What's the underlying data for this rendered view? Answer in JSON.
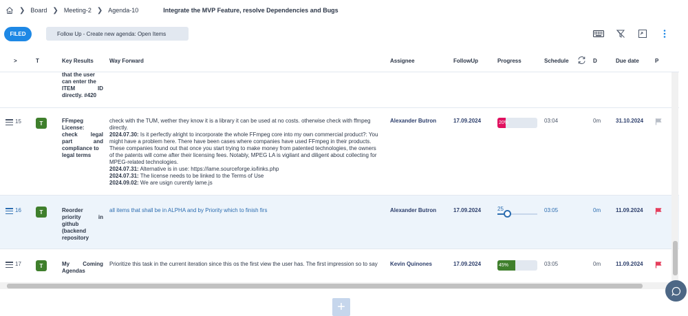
{
  "breadcrumb": {
    "items": [
      "Board",
      "Meeting-2",
      "Agenda-10"
    ],
    "title": "Integrate the MVP Feature, resolve Dependencies and Bugs"
  },
  "toolbar": {
    "filed_label": "FILED",
    "agenda_label": "Follow Up - Create new agenda: Open Items",
    "icons": [
      "keyboard-icon",
      "filter-off-icon",
      "fullscreen-icon",
      "more-vertical-icon"
    ]
  },
  "table": {
    "headers": {
      "expand": ">",
      "type": "T",
      "key_results": "Key Results",
      "way_forward": "Way Forward",
      "assignee": "Assignee",
      "followup": "FollowUp",
      "progress": "Progress",
      "schedule": "Schedule",
      "d": "D",
      "due_date": "Due date",
      "p": "P"
    },
    "partial_row": {
      "key_results_lines": [
        "that the user",
        "can enter the",
        "ITEM ID",
        "directly. #420"
      ]
    },
    "rows": [
      {
        "num": "15",
        "type": "T",
        "key_results_lines": [
          "FFmpeg",
          "License:",
          "check legal",
          "part and",
          "compliance to",
          "legal terms"
        ],
        "way_forward": {
          "intro": "check with the TUM, wether they know it is a library it can be used at no costs. otherwise check with ffmpeg directly.",
          "entries": [
            {
              "date": "2024.07.30:",
              "text": " Is it perfectly alright to incorporate the whole FFmpeg core into my own commercial product?: You might have a problem here. There have been cases where companies have used FFmpeg in their products. These companies found out that once you start trying to make money from patented technologies, the owners of the patents will come after their licensing fees. Notably, MPEG LA is vigilant and diligent about collecting for MPEG-related technologies."
            },
            {
              "date": "2024.07.31:",
              "text": "  Alternative is in use: https://lame.sourceforge.io/links.php"
            },
            {
              "date": "2024.07.31:",
              "text": "  The license needs to be linked to the Terms of Use"
            },
            {
              "date": "2024.09.02:",
              "text": "  We are usign curently lame.js"
            }
          ]
        },
        "assignee": "Alexander Butron",
        "followup": "17.09.2024",
        "progress": {
          "value": 20,
          "label": "20%",
          "color": "#e0115f"
        },
        "schedule": "03:04",
        "d": "0m",
        "due_date": "31.10.2024",
        "priority_color": "#b8bec7"
      },
      {
        "num": "16",
        "type": "T",
        "key_results_lines": [
          "Reorder",
          "priority in",
          "github",
          "(backend",
          "repository"
        ],
        "way_forward": "all items that shall be in ALPHA and by Priority which to finish firs",
        "assignee": "Alexander Butron",
        "followup": "17.09.2024",
        "progress": {
          "value": 25,
          "label": "25"
        },
        "schedule": "03:05",
        "d": "0m",
        "due_date": "11.09.2024",
        "priority_color": "#e53e5c"
      },
      {
        "num": "17",
        "type": "T",
        "key_results_lines": [
          "My Coming",
          "Agendas"
        ],
        "way_forward": "Prioritize this task in the current iteration since this os the first view the user has. The first impression so to say",
        "assignee": "Kevin Quinones",
        "followup": "17.09.2024",
        "progress": {
          "value": 45,
          "label": "45%",
          "color": "#3f7f2c"
        },
        "schedule": "03:05",
        "d": "0m",
        "due_date": "11.09.2024",
        "priority_color": "#e53e5c"
      }
    ]
  },
  "add_button_label": "+"
}
